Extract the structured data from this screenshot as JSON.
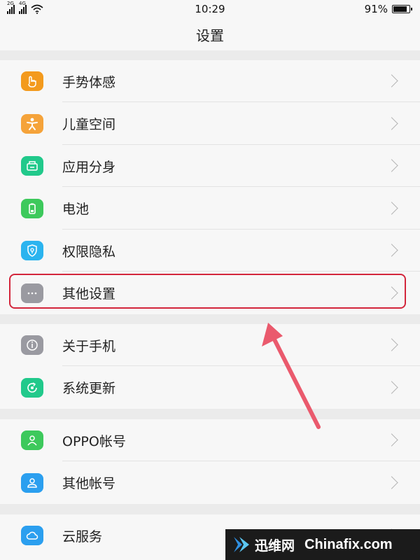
{
  "status_bar": {
    "signal1_tag": "2G",
    "signal2_tag": "4G",
    "time": "10:29",
    "battery_text": "91%",
    "battery_level": 0.91
  },
  "header": {
    "title": "设置"
  },
  "groups": [
    {
      "items": [
        {
          "label": "手势体感",
          "icon": "gesture-hand-icon",
          "color": "#f39a1d"
        },
        {
          "label": "儿童空间",
          "icon": "child-figure-icon",
          "color": "#f5a33a"
        },
        {
          "label": "应用分身",
          "icon": "app-clone-icon",
          "color": "#21c98b"
        },
        {
          "label": "电池",
          "icon": "battery-icon",
          "color": "#3dc95c"
        },
        {
          "label": "权限隐私",
          "icon": "shield-icon",
          "color": "#2bb4ef"
        },
        {
          "label": "其他设置",
          "icon": "more-dots-icon",
          "color": "#9a9aa1"
        }
      ]
    },
    {
      "items": [
        {
          "label": "关于手机",
          "icon": "info-icon",
          "color": "#9a9aa1"
        },
        {
          "label": "系统更新",
          "icon": "update-icon",
          "color": "#21c98b"
        }
      ]
    },
    {
      "items": [
        {
          "label": "OPPO帐号",
          "icon": "account-icon",
          "color": "#3dc95c"
        },
        {
          "label": "其他帐号",
          "icon": "other-account-icon",
          "color": "#2b9fef"
        }
      ]
    },
    {
      "items": [
        {
          "label": "云服务",
          "icon": "cloud-icon",
          "color": "#2b9fef"
        }
      ]
    }
  ],
  "annotation": {
    "highlight_color": "#d3263c",
    "arrow_color": "#ea5a6d"
  },
  "watermark": {
    "chinese": "迅维网",
    "english": "Chinafix.com"
  }
}
